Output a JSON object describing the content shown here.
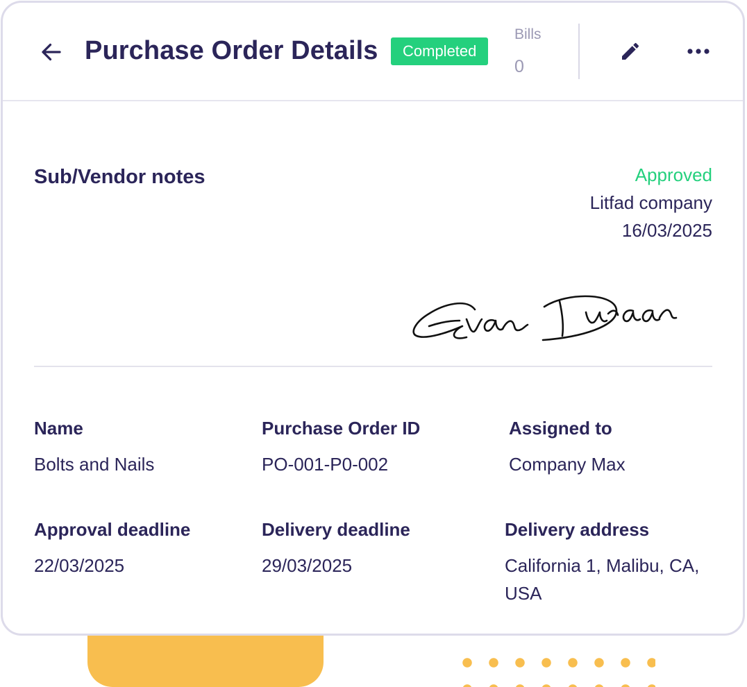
{
  "header": {
    "title": "Purchase Order Details",
    "status": "Completed",
    "bills_label": "Bills",
    "bills_count": "0"
  },
  "notes": {
    "title": "Sub/Vendor notes",
    "approval_status": "Approved",
    "approver_company": "Litfad company",
    "approval_date": "16/03/2025",
    "signature": "Evan Duraan"
  },
  "details": {
    "name_label": "Name",
    "name_value": "Bolts and Nails",
    "po_id_label": "Purchase Order ID",
    "po_id_value": "PO-001-P0-002",
    "assigned_label": "Assigned to",
    "assigned_value": "Company Max",
    "approval_deadline_label": "Approval deadline",
    "approval_deadline_value": "22/03/2025",
    "delivery_deadline_label": "Delivery deadline",
    "delivery_deadline_value": "29/03/2025",
    "delivery_address_label": "Delivery address",
    "delivery_address_value": "California 1, Malibu, CA, USA"
  },
  "icons": {
    "back": "arrow-left-icon",
    "edit": "pencil-icon",
    "more": "more-horizontal-icon"
  },
  "colors": {
    "primary_text": "#2b2559",
    "success": "#24d07d",
    "muted": "#9b99b4",
    "accent_yellow": "#f8be4f"
  }
}
